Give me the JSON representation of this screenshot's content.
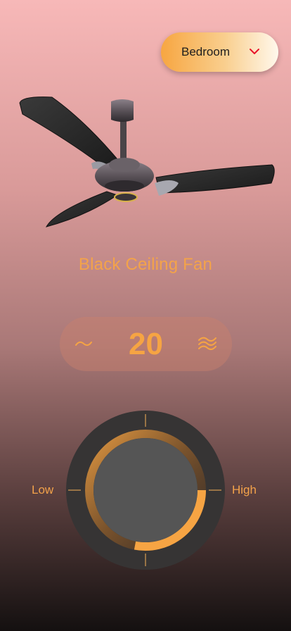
{
  "room_selector": {
    "label": "Bedroom",
    "icon": "chevron-down-icon",
    "icon_color": "#e8152b"
  },
  "device": {
    "name": "Black Ceiling Fan"
  },
  "speed": {
    "value": "20",
    "decrease_icon": "wave-low-icon",
    "increase_icon": "wave-high-icon"
  },
  "dial": {
    "low_label": "Low",
    "high_label": "High",
    "level_fraction": 0.28
  },
  "colors": {
    "accent": "#f6a443",
    "dial_track": "#3a3a3a",
    "dial_center": "#555555"
  }
}
